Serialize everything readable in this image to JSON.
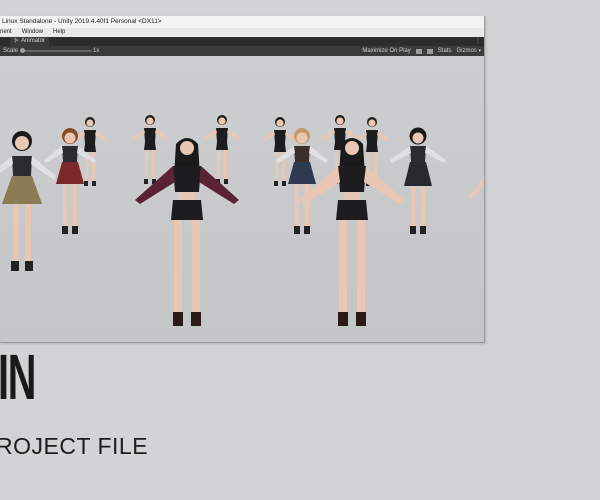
{
  "window": {
    "title": "Linux Standalone - Unity 2019.4.40f1 Personal <DX11>"
  },
  "menu": {
    "items": [
      "nent",
      "Window",
      "Help"
    ]
  },
  "tabbar": {
    "tab_label": "Animator",
    "tab_icon": "animator-icon",
    "menu_glyph": "⋮"
  },
  "toolbar": {
    "scale_label": "Scale",
    "scale_value": "1x",
    "scale_level": 0.0,
    "maximize_label": "Maximize On Play",
    "stats_label": "Stats",
    "gizmos_label": "Gizmos"
  },
  "promo": {
    "big_text": "IN",
    "sub_text": "ROJECT FILE"
  },
  "colors": {
    "background": "#d2d3d5",
    "toolbar": "#3b3b3b",
    "tabbar": "#2c2c2c",
    "viewport": "#c9cacc",
    "outfit_black": "#1d1d1f",
    "skirt_khaki": "#8b7b52",
    "skirt_red": "#7b2a2a",
    "skirt_navy": "#2f3a52",
    "jacket_maroon": "#5a2233",
    "skin": "#e8c8b4",
    "hair_black": "#1a1a1a"
  }
}
